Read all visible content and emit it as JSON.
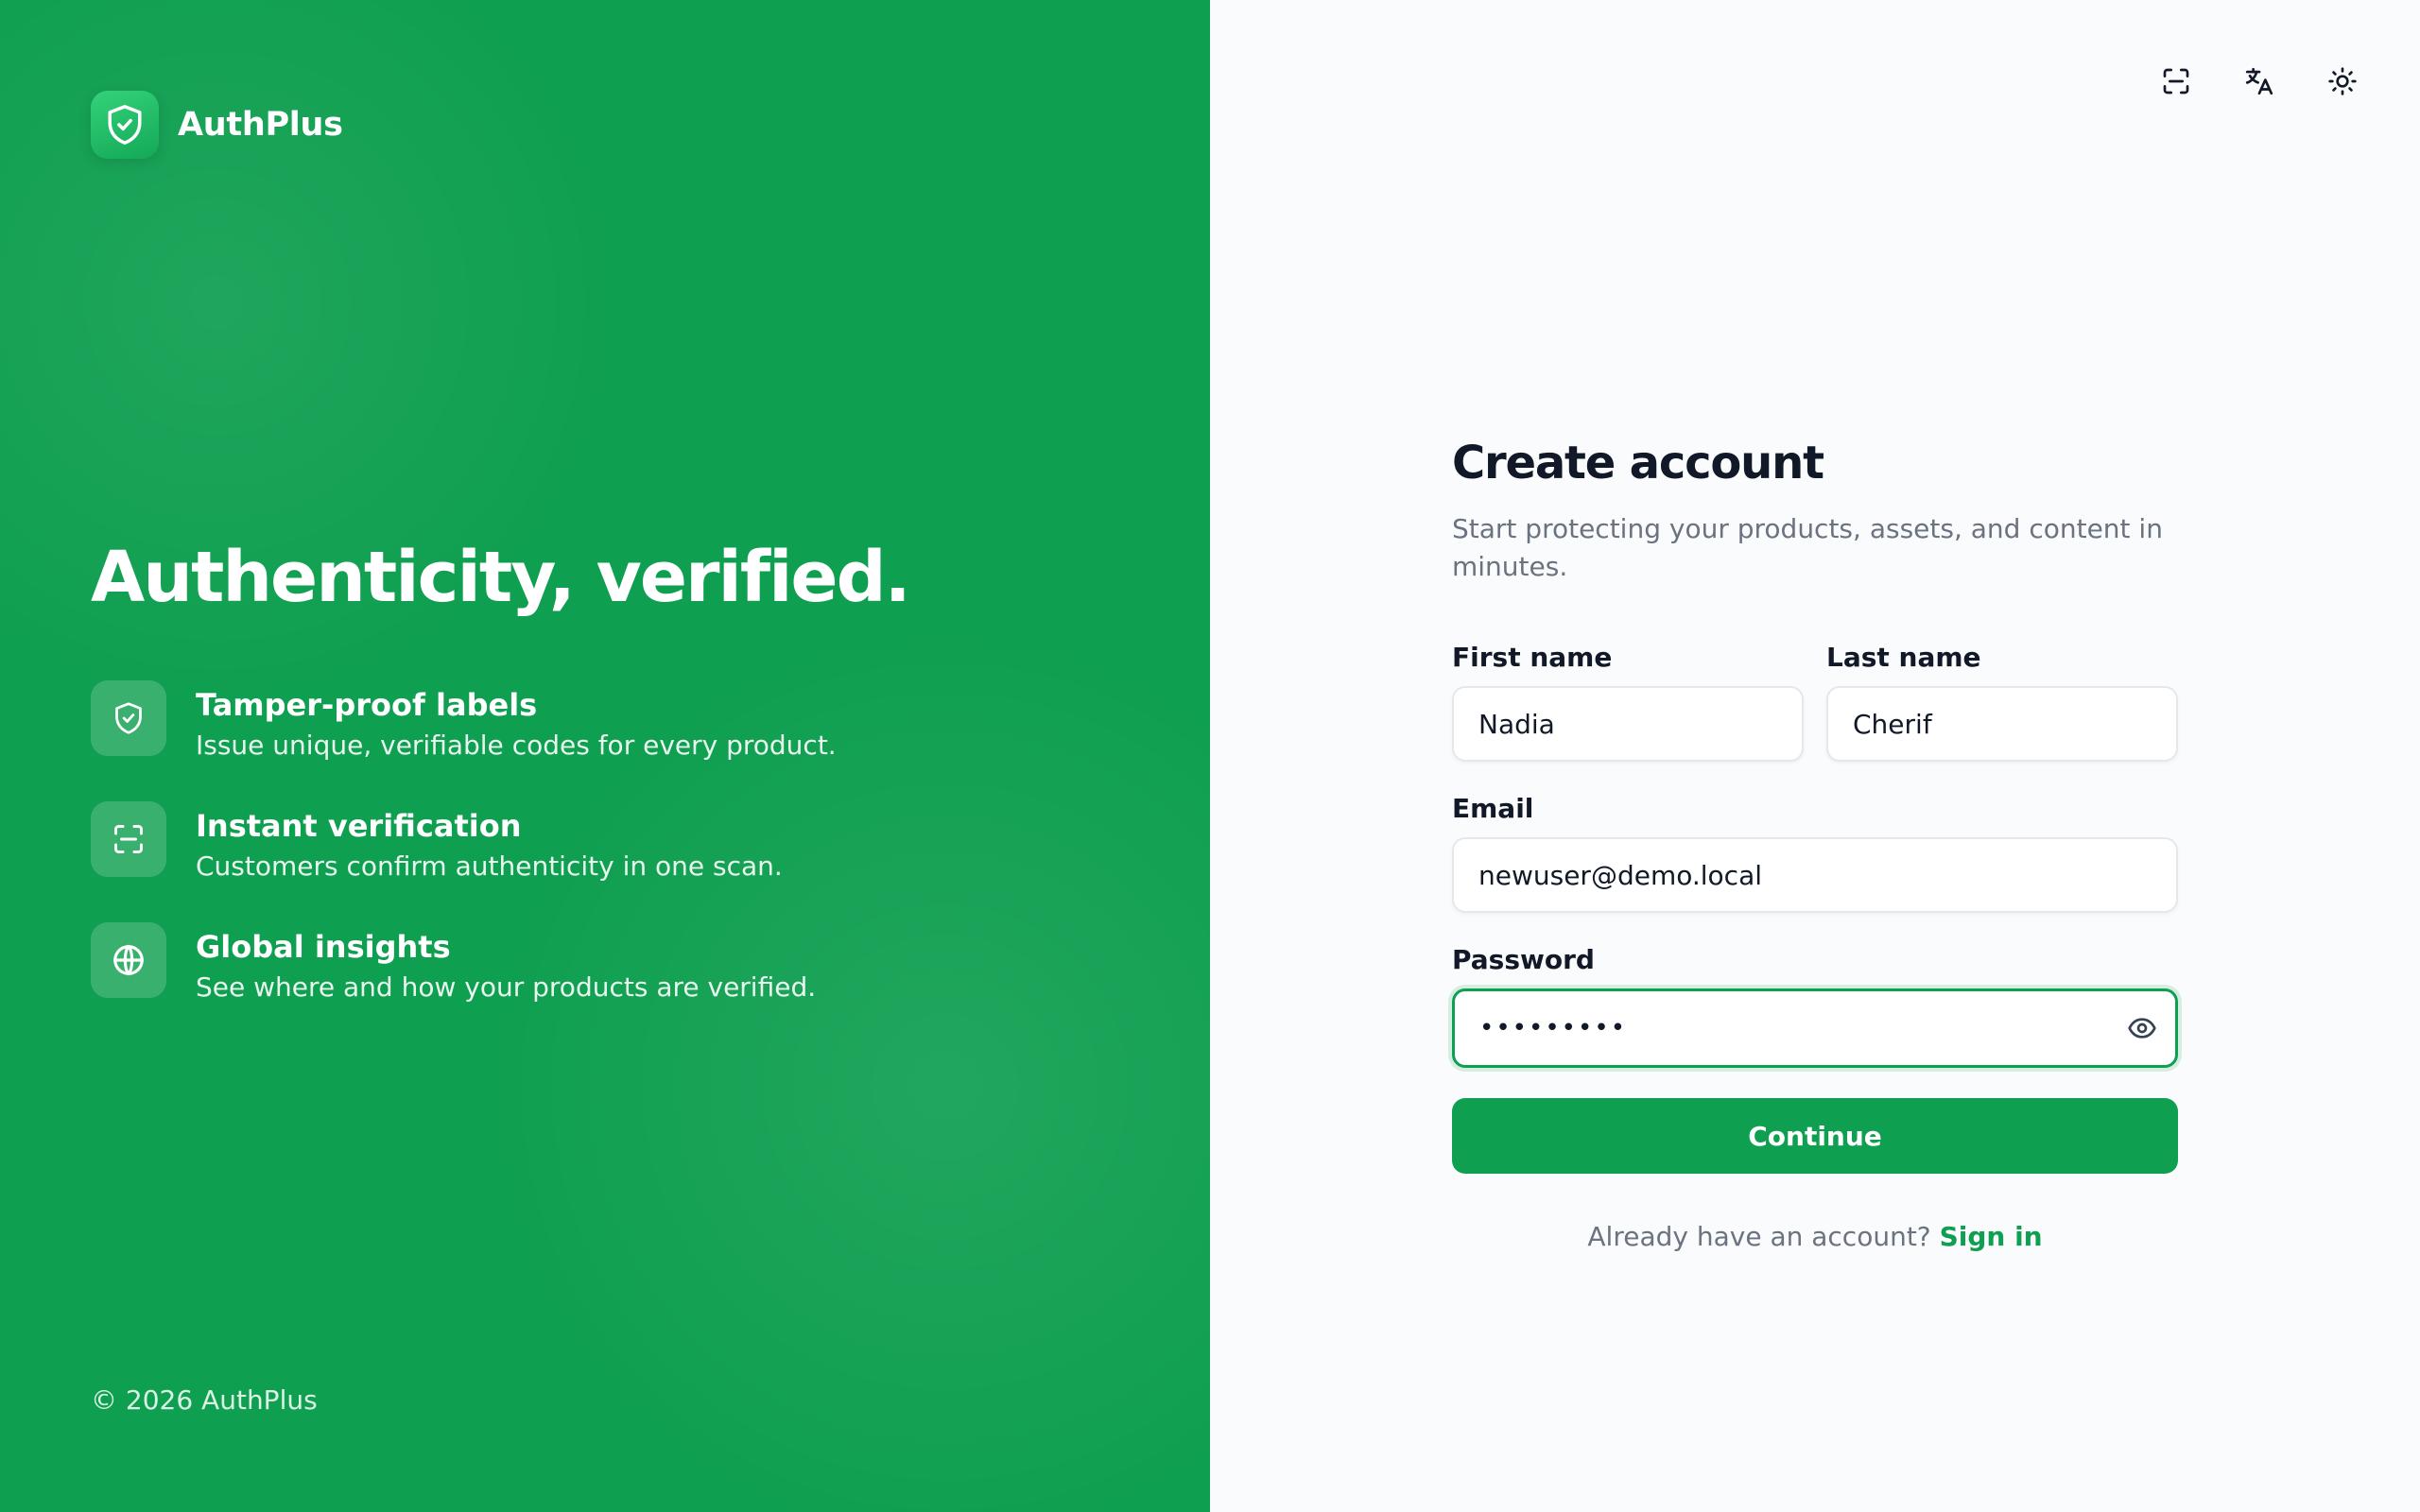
{
  "brand": {
    "name": "AuthPlus",
    "color": "#0f9f50",
    "icon": "shield-check-icon"
  },
  "hero": {
    "title": "Authenticity, verified."
  },
  "features": [
    {
      "icon": "shield-check-icon",
      "title": "Tamper-proof labels",
      "description": "Issue unique, verifiable codes for every product."
    },
    {
      "icon": "scan-icon",
      "title": "Instant verification",
      "description": "Customers confirm authenticity in one scan."
    },
    {
      "icon": "globe-icon",
      "title": "Global insights",
      "description": "See where and how your products are verified."
    }
  ],
  "footer": {
    "copyright": "© 2026 AuthPlus"
  },
  "toolbar": {
    "items": [
      {
        "icon": "scan-icon"
      },
      {
        "icon": "translate-icon"
      },
      {
        "icon": "sun-icon"
      }
    ]
  },
  "form": {
    "title": "Create account",
    "subtitle": "Start protecting your products, assets, and content in minutes.",
    "first_name": {
      "label": "First name",
      "value": "Nadia"
    },
    "last_name": {
      "label": "Last name",
      "value": "Cherif"
    },
    "email": {
      "label": "Email",
      "value": "newuser@demo.local"
    },
    "password": {
      "label": "Password",
      "value": "•••••••••",
      "toggle_icon": "eye-icon"
    },
    "submit_label": "Continue",
    "signin_prompt": "Already have an account?",
    "signin_link": "Sign in"
  }
}
